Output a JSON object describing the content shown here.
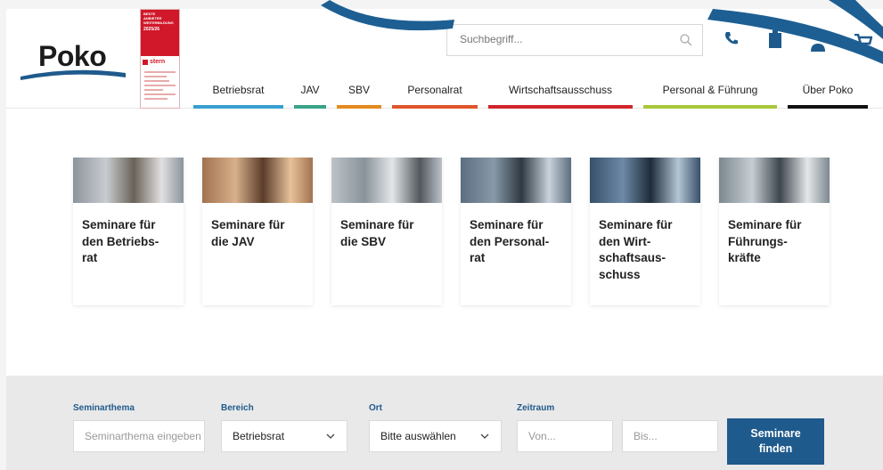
{
  "brand": {
    "name": "Poko"
  },
  "award": {
    "lines": [
      "BESTE",
      "ANBIETER",
      "WEITERBILDUNG"
    ],
    "year": "2025/26",
    "publisher": "stern"
  },
  "search": {
    "placeholder": "Suchbegriff..."
  },
  "header_icons": [
    "phone-icon",
    "clipboard-icon",
    "user-icon",
    "cart-icon"
  ],
  "nav": [
    {
      "label": "Betriebsrat",
      "color": "#3a9fd0"
    },
    {
      "label": "JAV",
      "color": "#3aa38a"
    },
    {
      "label": "SBV",
      "color": "#e48a20"
    },
    {
      "label": "Personalrat",
      "color": "#e0562a"
    },
    {
      "label": "Wirtschaftsausschuss",
      "color": "#d0262a"
    },
    {
      "label": "Personal & Führung",
      "color": "#a8c83a"
    },
    {
      "label": "Über Poko",
      "color": "#111111"
    }
  ],
  "cards": [
    {
      "title": "Seminare für\nden Betriebs-\nrat"
    },
    {
      "title": "Seminare für\ndie JAV"
    },
    {
      "title": "Seminare für\ndie SBV"
    },
    {
      "title": "Seminare für\nden Personal-\nrat"
    },
    {
      "title": "Seminare für\nden Wirt-\nschaftsaus-\nschuss"
    },
    {
      "title": "Seminare für\nFührungs-\nkräfte"
    }
  ],
  "finder": {
    "topic": {
      "label": "Seminarthema",
      "placeholder": "Seminarthema eingeben"
    },
    "area": {
      "label": "Bereich",
      "value": "Betriebsrat"
    },
    "place": {
      "label": "Ort",
      "value": "Bitte auswählen"
    },
    "period": {
      "label": "Zeitraum",
      "from_placeholder": "Von...",
      "to_placeholder": "Bis..."
    },
    "button": "Seminare\nfinden"
  },
  "colors": {
    "brand_blue": "#1f5a8c",
    "swoosh_blue": "#1d5f93"
  }
}
